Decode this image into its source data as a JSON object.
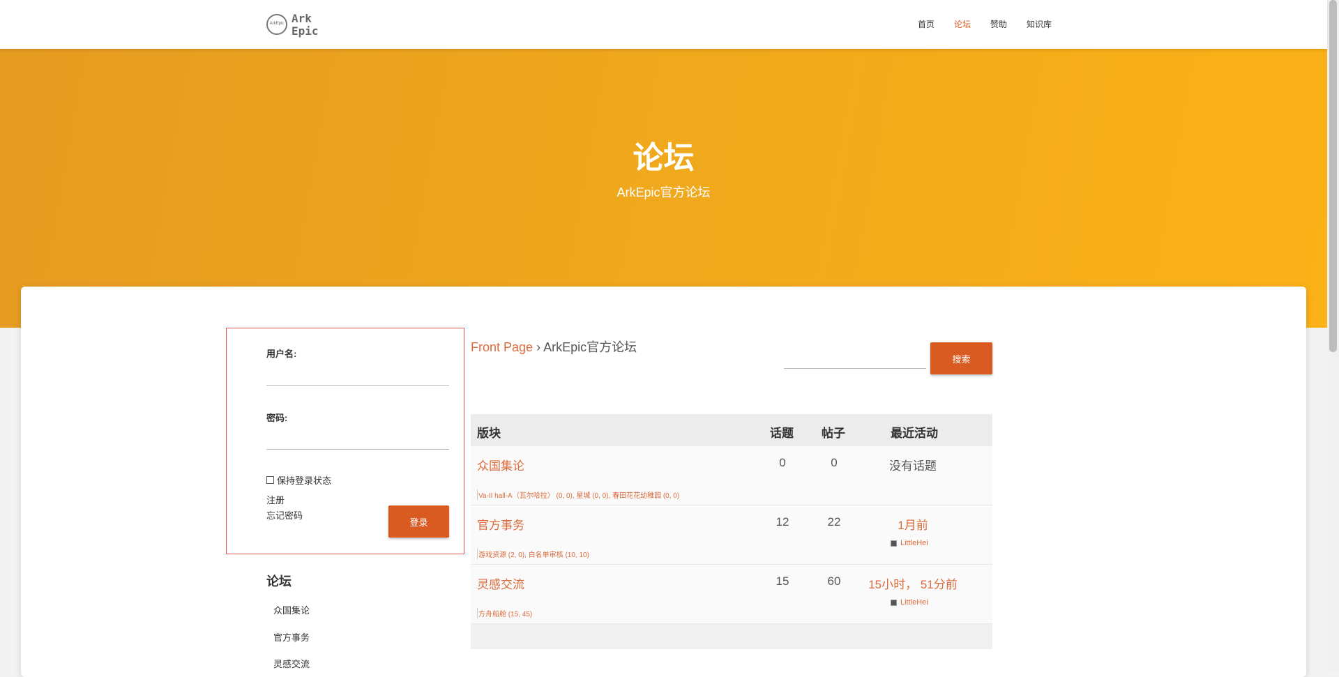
{
  "logo": {
    "ring_text": "ArkEpic",
    "wordmark_line1": "Ark",
    "wordmark_line2": "Epic"
  },
  "nav": {
    "items": [
      "首页",
      "论坛",
      "赞助",
      "知识库"
    ],
    "active": "论坛"
  },
  "hero": {
    "title": "论坛",
    "subtitle": "ArkEpic官方论坛"
  },
  "login": {
    "username_label": "用户名:",
    "username_value": "",
    "password_label": "密码:",
    "password_value": "",
    "remember_label": "保持登录状态",
    "register_link": "注册",
    "forgot_link": "忘记密码",
    "login_button": "登录"
  },
  "sidebar": {
    "title": "论坛",
    "items": [
      "众国集论",
      "官方事务",
      "灵感交流"
    ]
  },
  "breadcrumb": {
    "link": "Front Page",
    "separator": " › ",
    "current": "ArkEpic官方论坛"
  },
  "search": {
    "button": "搜索",
    "value": ""
  },
  "table": {
    "headers": {
      "forum": "版块",
      "topics": "话题",
      "posts": "帖子",
      "activity": "最近活动"
    },
    "rows": [
      {
        "name": "众国集论",
        "sub": "Va-II hall-A（瓦尔哈拉） (0, 0), 星城 (0, 0), 春田花花幼稚园 (0, 0)",
        "topics": "0",
        "posts": "0",
        "activity": "没有话题",
        "activity_color": "#555555",
        "user": ""
      },
      {
        "name": "官方事务",
        "sub": "游戏资源 (2, 0), 白名单审核 (10, 10)",
        "topics": "12",
        "posts": "22",
        "activity": "1月前",
        "activity_color": "#d96b3c",
        "user": "LittleHei"
      },
      {
        "name": "灵感交流",
        "sub": "方舟船舱 (15, 45)",
        "topics": "15",
        "posts": "60",
        "activity": "15小时， 51分前",
        "activity_color": "#d96b3c",
        "user": "LittleHei"
      }
    ]
  },
  "colors": {
    "accent": "#d95b22",
    "link": "#d96b3c",
    "hero_start": "#e69b21",
    "hero_end": "#fbb117"
  }
}
